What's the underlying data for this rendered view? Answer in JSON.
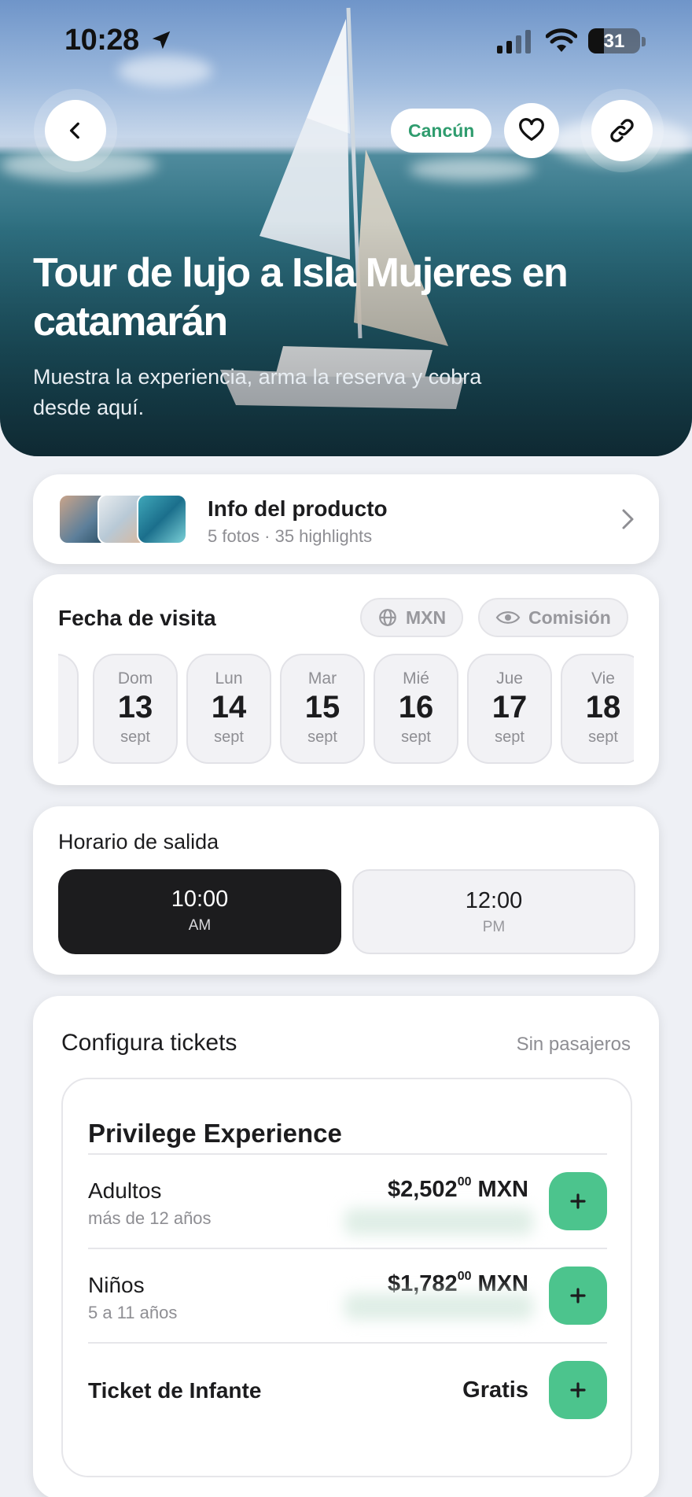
{
  "status_bar": {
    "time": "10:28",
    "battery": "31",
    "battery_level": 0.31
  },
  "hero": {
    "city": "Cancún",
    "title": "Tour de lujo a Isla Mujeres en catamarán",
    "subtitle": "Muestra la experiencia, arma la reserva y cobra desde aquí."
  },
  "product_info": {
    "title": "Info del producto",
    "subtitle": "5 fotos · 35 highlights"
  },
  "date_picker": {
    "title": "Fecha de visita",
    "currency_chip": "MXN",
    "commission_chip": "Comisión",
    "days": [
      {
        "weekday": "Dom",
        "day": "13",
        "month": "sept"
      },
      {
        "weekday": "Lun",
        "day": "14",
        "month": "sept"
      },
      {
        "weekday": "Mar",
        "day": "15",
        "month": "sept"
      },
      {
        "weekday": "Mié",
        "day": "16",
        "month": "sept"
      },
      {
        "weekday": "Jue",
        "day": "17",
        "month": "sept"
      },
      {
        "weekday": "Vie",
        "day": "18",
        "month": "sept"
      }
    ]
  },
  "departure": {
    "title": "Horario de salida",
    "slots": [
      {
        "time": "10:00",
        "period": "AM",
        "selected": true
      },
      {
        "time": "12:00",
        "period": "PM",
        "selected": false
      }
    ]
  },
  "tickets": {
    "title": "Configura tickets",
    "status": "Sin pasajeros",
    "experience": "Privilege Experience",
    "rows": [
      {
        "name": "Adultos",
        "age": "más de 12 años",
        "price": "$2,502",
        "cents": "00",
        "currency": "MXN"
      },
      {
        "name": "Niños",
        "age": "5 a 11 años",
        "price": "$1,782",
        "cents": "00",
        "currency": "MXN"
      },
      {
        "name": "Ticket de Infante",
        "age": "",
        "price": "Gratis",
        "cents": "",
        "currency": ""
      }
    ]
  },
  "colors": {
    "accent_green": "#4cc48d",
    "city_green": "#2f9c6e",
    "selected_dark": "#1c1c1e"
  },
  "icons": [
    "back-chevron-icon",
    "heart-icon",
    "link-icon",
    "location-arrow-icon",
    "signal-icon",
    "wifi-icon",
    "battery-icon",
    "globe-icon",
    "eye-icon",
    "chevron-right-icon",
    "plus-icon"
  ]
}
